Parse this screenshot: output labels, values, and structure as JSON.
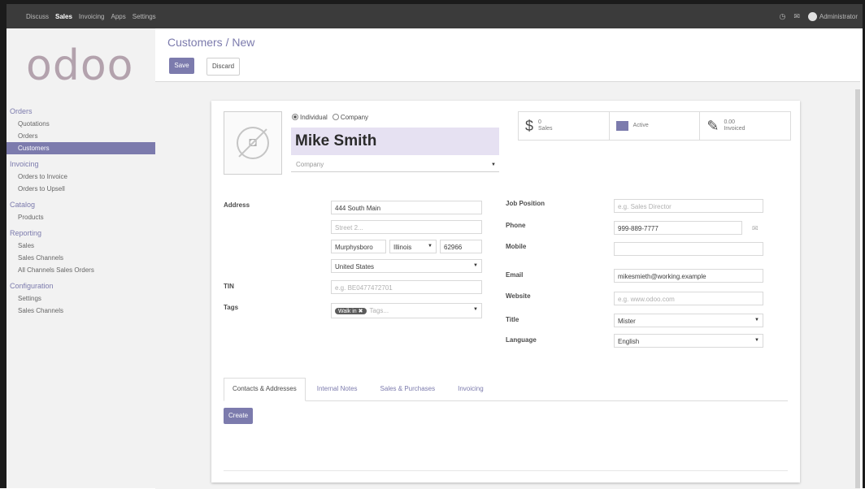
{
  "topbar": {
    "nav": [
      "Discuss",
      "Sales",
      "Invoicing",
      "Apps",
      "Settings"
    ],
    "active_nav": "Sales",
    "user": "Administrator"
  },
  "sidebar": {
    "logo": "odoo",
    "sections": [
      {
        "title": "Orders",
        "items": [
          "Quotations",
          "Orders",
          "Customers"
        ]
      },
      {
        "title": "Invoicing",
        "items": [
          "Orders to Invoice",
          "Orders to Upsell"
        ]
      },
      {
        "title": "Catalog",
        "items": [
          "Products"
        ]
      },
      {
        "title": "Reporting",
        "items": [
          "Sales",
          "Sales Channels",
          "All Channels Sales Orders"
        ]
      },
      {
        "title": "Configuration",
        "items": [
          "Settings",
          "Sales Channels"
        ]
      }
    ],
    "active_item": "Customers"
  },
  "control": {
    "breadcrumb": "Customers / New",
    "save_label": "Save",
    "discard_label": "Discard"
  },
  "header": {
    "individual_label": "Individual",
    "company_label": "Company",
    "selected_type": "Individual",
    "name": "Mike Smith",
    "company_placeholder": "Company"
  },
  "stats": {
    "sales_count": "0",
    "sales_label": "Sales",
    "active_label": "Active",
    "invoiced_amount": "0.00",
    "invoiced_label": "Invoiced"
  },
  "left_fields": {
    "address_label": "Address",
    "street": "444 South Main",
    "street2_placeholder": "Street 2...",
    "city": "Murphysboro",
    "state": "Illinois",
    "zip": "62966",
    "country": "United States",
    "tin_label": "TIN",
    "tin_placeholder": "e.g. BE0477472701",
    "tags_label": "Tags",
    "tag_value": "Walk in",
    "tags_placeholder": "Tags..."
  },
  "right_fields": {
    "job_position_label": "Job Position",
    "job_position_placeholder": "e.g. Sales Director",
    "phone_label": "Phone",
    "phone": "999-889-7777",
    "mobile_label": "Mobile",
    "mobile": "",
    "email_label": "Email",
    "email": "mikesmieth@working.example",
    "website_label": "Website",
    "website_placeholder": "e.g. www.odoo.com",
    "title_label": "Title",
    "title": "Mister",
    "language_label": "Language",
    "language": "English"
  },
  "tabs": [
    "Contacts & Addresses",
    "Internal Notes",
    "Sales & Purchases",
    "Invoicing"
  ],
  "active_tab": "Contacts & Addresses",
  "create_label": "Create",
  "colors": {
    "accent": "#7c7bad",
    "topbar": "#3b3b3b",
    "name_bg": "#e6e1f2"
  }
}
